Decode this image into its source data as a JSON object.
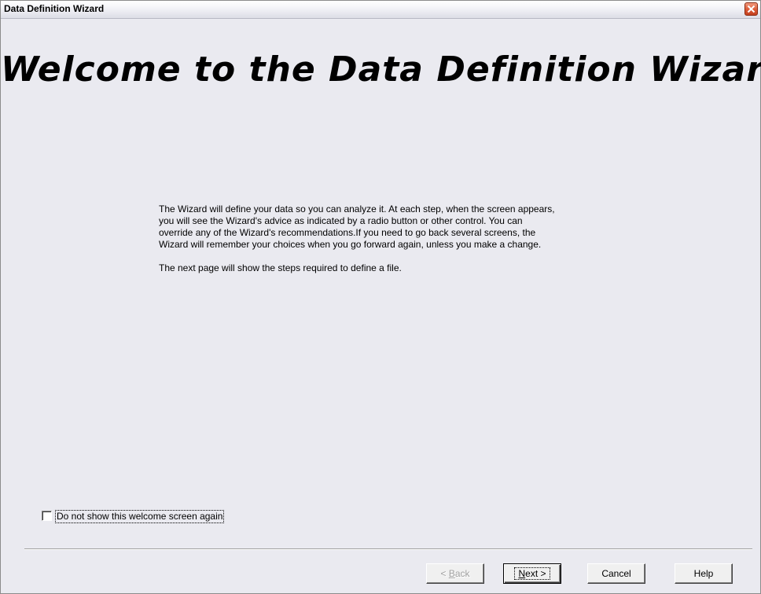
{
  "window": {
    "title": "Data Definition Wizard"
  },
  "main": {
    "heading": "Welcome to the Data Definition Wizard",
    "paragraph1_lines": [
      "The Wizard will define your data so you can analyze it. At each step, when the screen appears,",
      "you will see the Wizard's advice as indicated by a radio button or other control. You can",
      "override any of the Wizard's recommendations.If you need to go back several screens, the",
      "Wizard will remember your choices when you go forward again, unless you make a change."
    ],
    "paragraph2": "The next page will show the steps required to define a file."
  },
  "options": {
    "dont_show_label": "Do not show this welcome screen again",
    "dont_show_checked": false
  },
  "buttons": {
    "back_prefix": "< ",
    "back_mnemonic": "B",
    "back_rest": "ack",
    "back_enabled": false,
    "next_mnemonic": "N",
    "next_rest": "ext >",
    "cancel_label": "Cancel",
    "help_label": "Help"
  },
  "icons": {
    "close": "close-icon"
  }
}
